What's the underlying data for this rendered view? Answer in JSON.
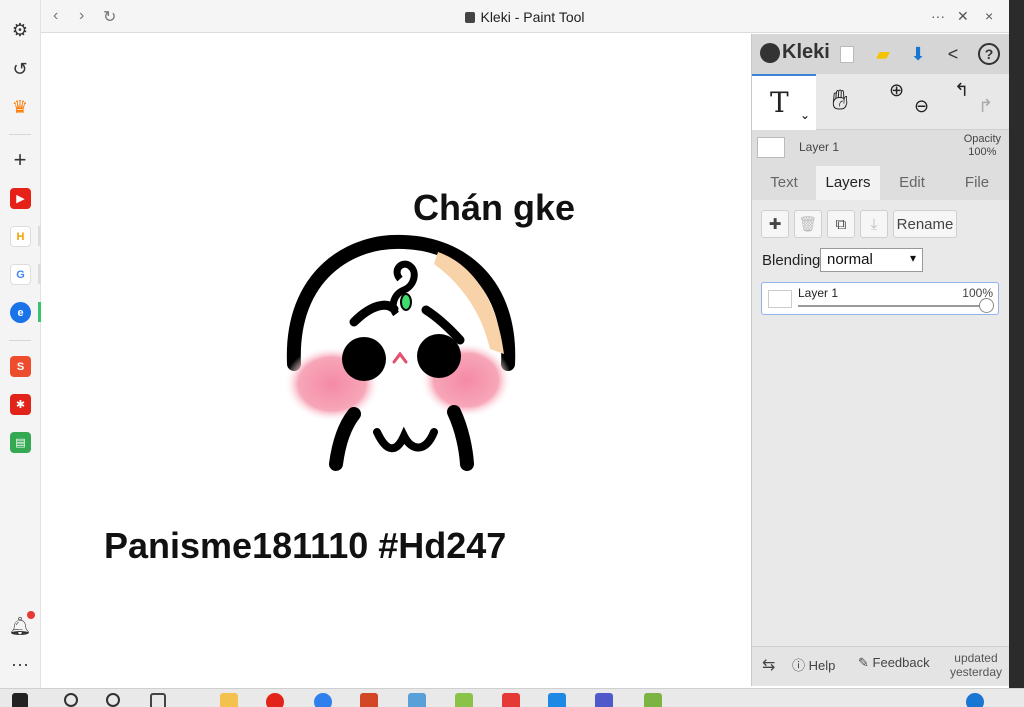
{
  "browser": {
    "title": "Kleki - Paint Tool",
    "controls": {
      "more": "···",
      "close": "×"
    }
  },
  "canvas": {
    "caption_top": "Chán gke",
    "caption_bottom": "Panisme181110 #Hd247"
  },
  "panel": {
    "logo_text": "Kleki",
    "layer_name": "Layer 1",
    "opacity_label": "Opacity",
    "opacity_value": "100%",
    "tabs": [
      "Text",
      "Layers",
      "Edit",
      "File"
    ],
    "active_tab": "Layers",
    "rename_label": "Rename",
    "blending_label": "Blending",
    "blending_value": "normal",
    "layer_card": {
      "name": "Layer 1",
      "percent": "100%"
    },
    "footer": {
      "help": "Help",
      "feedback": "Feedback",
      "updated_line1": "updated",
      "updated_line2": "yesterday"
    }
  },
  "colors": {
    "accent": "#3b82d6",
    "panel_bg": "#dedede",
    "blush": "#f59ab0",
    "leaf": "#3ddc6c"
  },
  "icons": [
    "settings-icon",
    "history-icon",
    "crown-icon",
    "plus-icon",
    "youtube-icon",
    "bell-icon",
    "more-icon"
  ]
}
